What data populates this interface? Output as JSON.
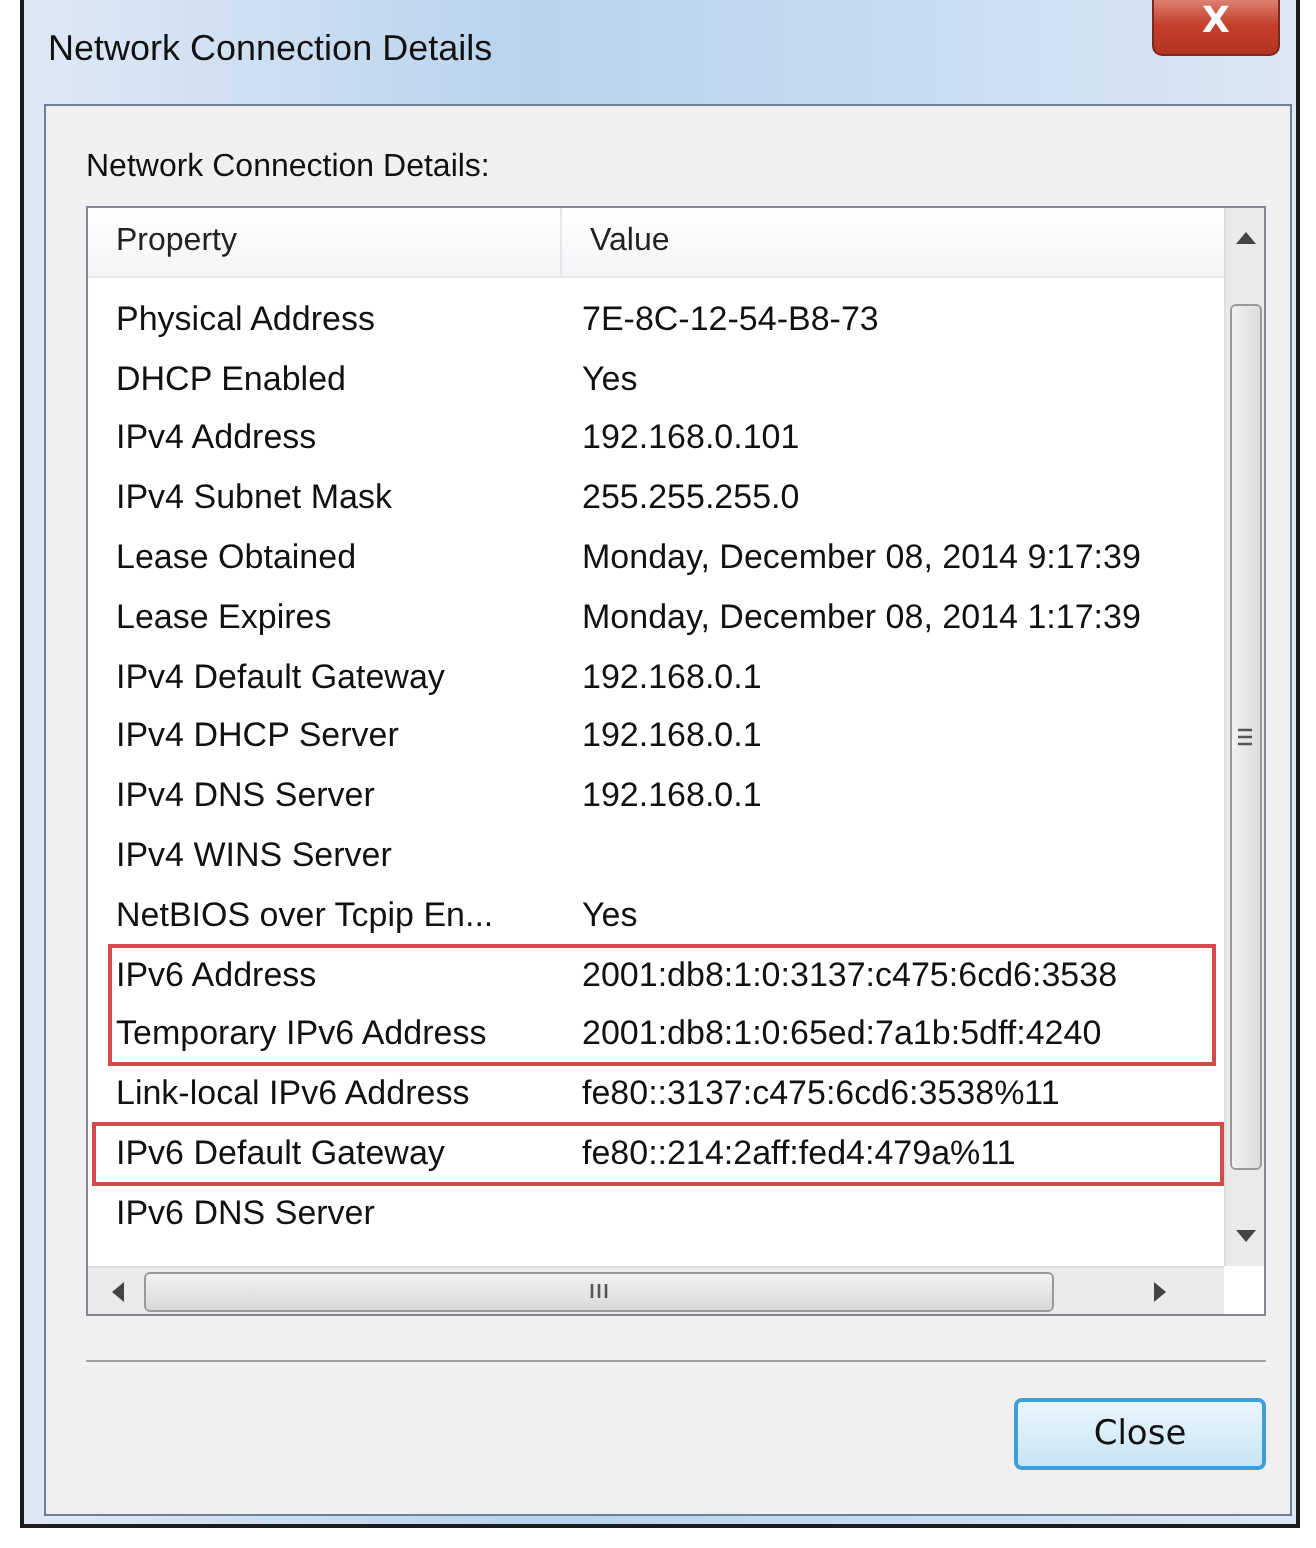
{
  "window": {
    "title": "Network Connection Details",
    "close_glyph": "X"
  },
  "label": "Network Connection Details:",
  "table": {
    "columns": [
      "Property",
      "Value"
    ],
    "rows": [
      {
        "property": "Physical Address",
        "value": "7E-8C-12-54-B8-73",
        "highlighted": false
      },
      {
        "property": "DHCP Enabled",
        "value": "Yes",
        "highlighted": false
      },
      {
        "property": "IPv4 Address",
        "value": "192.168.0.101",
        "highlighted": false
      },
      {
        "property": "IPv4 Subnet Mask",
        "value": "255.255.255.0",
        "highlighted": false
      },
      {
        "property": "Lease Obtained",
        "value": "Monday, December 08, 2014 9:17:39",
        "highlighted": false
      },
      {
        "property": "Lease Expires",
        "value": "Monday, December 08, 2014 1:17:39",
        "highlighted": false
      },
      {
        "property": "IPv4 Default Gateway",
        "value": "192.168.0.1",
        "highlighted": false
      },
      {
        "property": "IPv4 DHCP Server",
        "value": "192.168.0.1",
        "highlighted": false
      },
      {
        "property": "IPv4 DNS Server",
        "value": "192.168.0.1",
        "highlighted": false
      },
      {
        "property": "IPv4 WINS Server",
        "value": "",
        "highlighted": false
      },
      {
        "property": "NetBIOS over Tcpip En...",
        "value": "Yes",
        "highlighted": false
      },
      {
        "property": "IPv6 Address",
        "value": "2001:db8:1:0:3137:c475:6cd6:3538",
        "highlighted": true
      },
      {
        "property": "Temporary IPv6 Address",
        "value": "2001:db8:1:0:65ed:7a1b:5dff:4240",
        "highlighted": true
      },
      {
        "property": "Link-local IPv6 Address",
        "value": "fe80::3137:c475:6cd6:3538%11",
        "highlighted": false
      },
      {
        "property": "IPv6 Default Gateway",
        "value": "fe80::214:2aff:fed4:479a%11",
        "highlighted": true
      },
      {
        "property": "IPv6 DNS Server",
        "value": "",
        "highlighted": false
      }
    ]
  },
  "buttons": [
    "Close"
  ]
}
